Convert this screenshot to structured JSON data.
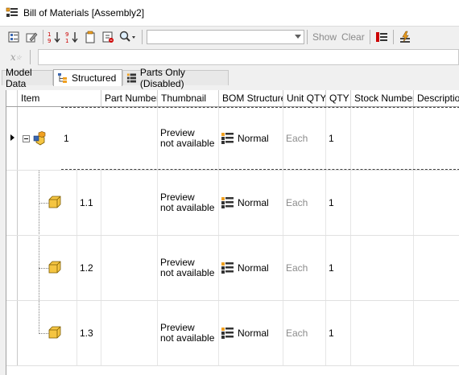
{
  "window": {
    "title": "Bill of Materials [Assembly2]",
    "icon": "bom-window-icon"
  },
  "toolbar": {
    "buttons": [
      {
        "name": "view-options-icon"
      },
      {
        "name": "edit-icon"
      },
      {
        "name": "sort-ascending-icon"
      },
      {
        "name": "sort-descending-icon"
      },
      {
        "name": "clipboard-icon"
      },
      {
        "name": "export-icon"
      },
      {
        "name": "find-icon"
      }
    ],
    "combo_value": "",
    "show_label": "Show",
    "clear_label": "Clear",
    "fx_label": "x",
    "formula_value": ""
  },
  "tabs": [
    {
      "label": "Model Data",
      "active": false
    },
    {
      "label": "Structured",
      "active": true
    },
    {
      "label": "Parts Only (Disabled)",
      "active": false
    }
  ],
  "columns": [
    "Item",
    "Part Number",
    "Thumbnail",
    "BOM Structure",
    "Unit QTY",
    "QTY",
    "Stock Number",
    "Description"
  ],
  "rows": [
    {
      "item": "1",
      "part_number": "",
      "thumb_line1": "Preview",
      "thumb_line2": "not available",
      "bom": "Normal",
      "unit_qty": "Each",
      "qty": "1",
      "stock": "",
      "desc": ""
    },
    {
      "item": "1.1",
      "part_number": "",
      "thumb_line1": "Preview",
      "thumb_line2": "not available",
      "bom": "Normal",
      "unit_qty": "Each",
      "qty": "1",
      "stock": "",
      "desc": ""
    },
    {
      "item": "1.2",
      "part_number": "",
      "thumb_line1": "Preview",
      "thumb_line2": "not available",
      "bom": "Normal",
      "unit_qty": "Each",
      "qty": "1",
      "stock": "",
      "desc": ""
    },
    {
      "item": "1.3",
      "part_number": "",
      "thumb_line1": "Preview",
      "thumb_line2": "not available",
      "bom": "Normal",
      "unit_qty": "Each",
      "qty": "1",
      "stock": "",
      "desc": ""
    }
  ],
  "colors": {
    "accent_orange": "#f0a020",
    "part_yellow": "#f5c542",
    "assembly_blue": "#3a66b0"
  }
}
